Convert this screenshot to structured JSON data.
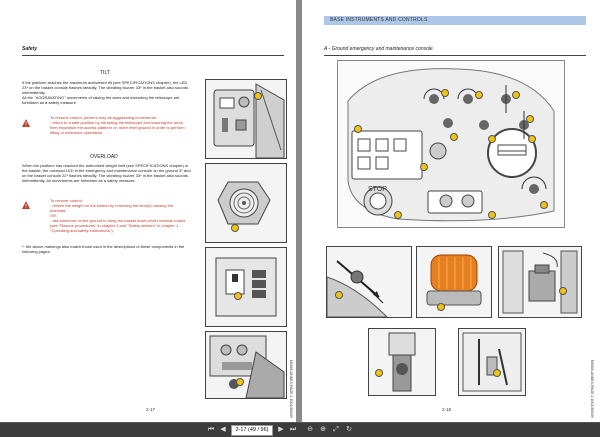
{
  "left_page": {
    "section_title": "Safety",
    "subtitle_tilt": "TILT",
    "para_tilt_1": "If the platform reaches the maximum authorised tilt (see SPECIFICATIONS chapter), the LED 23* on the basket console flashes steadily. The vibrating buzzer 33* in the basket also sounds intermittently.",
    "para_tilt_2": "All the \"AGGRAVATING\" movements of raising the arms and extending the telescope are forbidden as a safety measure.",
    "red_tilt_1": "To resume control, perform only de-aggravating movements:",
    "red_tilt_2": "- return to a safe position by retracting the telescope and lowering the arms, then reposition the access platform on more level ground in order to perform lifting or extension operations.",
    "subtitle_overload": "OVERLOAD",
    "para_overload": "When the platform has reached the authorised weight limit (see SPECIFICATIONS chapter) in the basket, the overload LED in the emergency and maintenance console on the ground 3* and on the basket console 22* flashes steadily. The vibrating buzzer 33* in the basket also sounds intermittently. All movements are forbidden as a safety measure.",
    "red_ov_1": "To recover control:",
    "red_ov_2": "- relieve the weight on the basket by removing the item(s) causing the overload.",
    "red_ov_3": "OR,",
    "red_ov_4": "- ask someone on the ground to bring the basket down under manual control (see \"Rescue procedures\" in chapter 3 and \"Safety stickers\" in chapter 1 - \"Operating and safety instructions\").",
    "footnote": "*: the above markings also match those used in the descriptions of these components in the following pages.",
    "page_number": "2-17",
    "side_code": "M0005-ANNEX-PAGE 2",
    "side_code2": "1001/300/09"
  },
  "right_page": {
    "banner_title": "BASE INSTRUMENTS AND CONTROLS",
    "section_title": "A - Ground emergency and maintenance console",
    "page_number": "2-18",
    "side_code": "M0005-ANNEX-PAGE 2",
    "side_code2": "1001/300/09",
    "stop_label": "STOP"
  },
  "toolbar": {
    "first": "⏮",
    "prev": "◀",
    "page_field": "2-17 (49 / 96)",
    "next": "▶",
    "last": "⏭",
    "zoom_out": "⊖",
    "zoom_in": "⊕",
    "fit": "⤢",
    "rotate": "↻"
  },
  "colors": {
    "accent_banner": "#aec6e8",
    "warning_red": "#c0392b",
    "callout_yellow": "#f1c40f",
    "beacon_orange": "#e67e22"
  }
}
